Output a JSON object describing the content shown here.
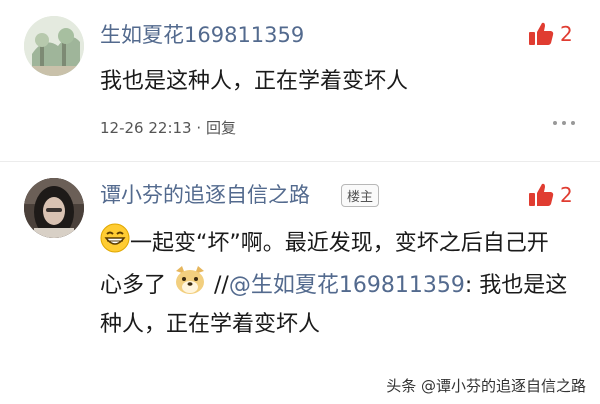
{
  "comments": [
    {
      "username": "生如夏花169811359",
      "like_count": "2",
      "text": "我也是这种人，正在学着变坏人",
      "date": "12-26 22:13",
      "separator": "·",
      "reply_label": "回复"
    },
    {
      "username": "谭小芬的追逐自信之路",
      "badge": "楼主",
      "like_count": "2",
      "text_part1": "一起变“坏”啊。最近发现，变坏之后自己开心多了",
      "mention_prefix": " //",
      "mention_user": "@生如夏花169811359",
      "quoted_text": ": 我也是这种人，正在学着变坏人"
    }
  ],
  "watermark": "头条 @谭小芬的追逐自信之路",
  "colors": {
    "username": "#536a8e",
    "like_red": "#e03c31",
    "text": "#1a1a1a"
  }
}
